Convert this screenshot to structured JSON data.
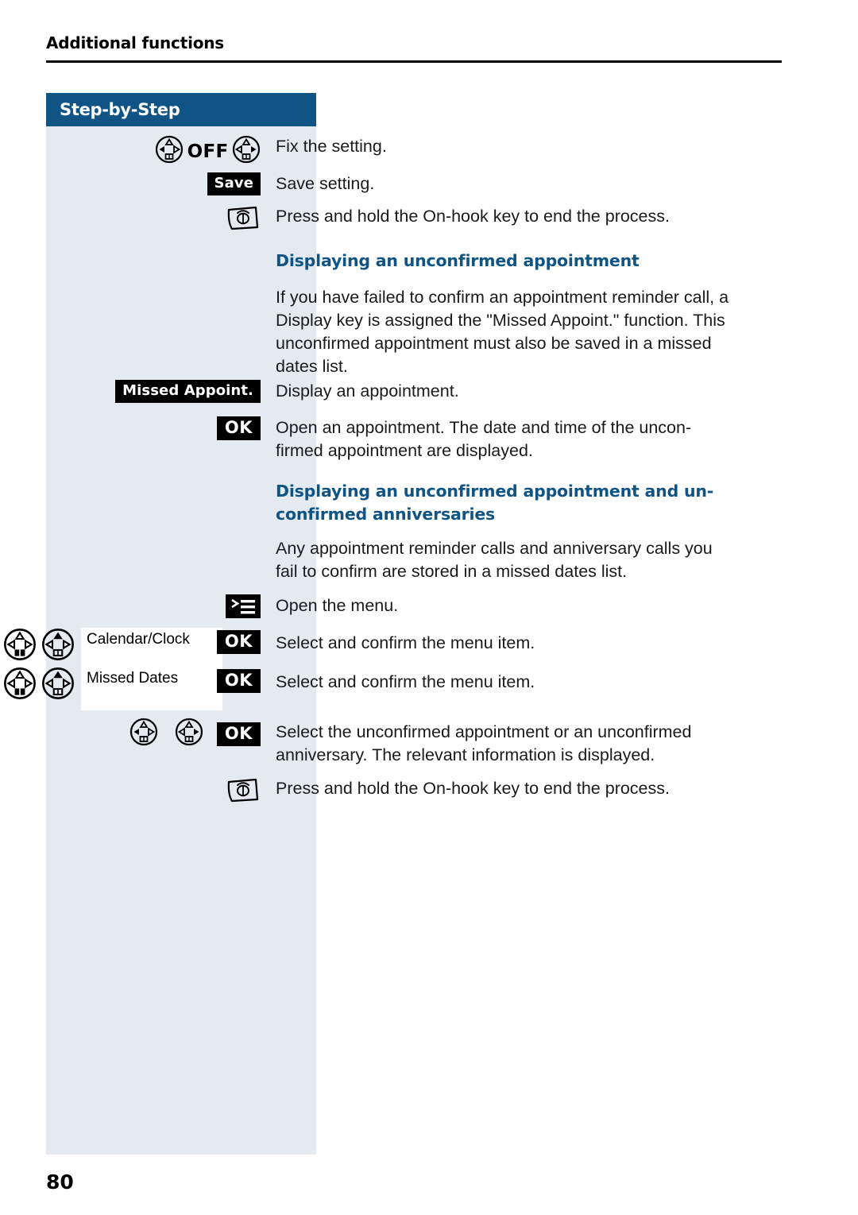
{
  "page": {
    "running_head": "Additional functions",
    "banner_title": "Step-by-Step",
    "page_number": "80",
    "colors": {
      "banner_blue": "#0f5485",
      "column_tint": "#e5eaf1",
      "heading_blue": "#0f5485",
      "keycap_black": "#000000"
    }
  },
  "rows": [
    {
      "id": "fix-setting",
      "gutter": {
        "type": "navkeys-with-label",
        "left_key": "nav-key-left-icon",
        "label": "OFF",
        "right_key": "nav-key-right-icon"
      },
      "text": "Fix the setting."
    },
    {
      "id": "save-setting",
      "gutter": {
        "type": "keycap",
        "label": "Save"
      },
      "text": "Save setting."
    },
    {
      "id": "on-hook-end-1",
      "gutter": {
        "type": "icon",
        "icon": "on-hook-key-icon"
      },
      "text": "Press and hold the On-hook key to end the process."
    },
    {
      "id": "heading-displaying-unconfirmed",
      "gutter": {
        "type": "none"
      },
      "heading": "Displaying an unconfirmed appointment"
    },
    {
      "id": "paragraph-missed-appoint",
      "gutter": {
        "type": "none"
      },
      "text": "If you have failed to confirm an appointment reminder call, a Display key is assigned the \"Missed Appoint.\" function. This unconfirmed appointment must also be saved in a missed dates list."
    },
    {
      "id": "display-appointment",
      "gutter": {
        "type": "keycap",
        "label": "Missed Appoint."
      },
      "text": "Display an appointment."
    },
    {
      "id": "open-appointment",
      "gutter": {
        "type": "keycap-ok",
        "label": "OK"
      },
      "text": "Open an appointment. The date and time of the uncon-firmed appointment are displayed."
    },
    {
      "id": "heading-displaying-unconfirmed-anniversaries",
      "gutter": {
        "type": "none"
      },
      "heading": "Displaying an unconfirmed appointment and un-confirmed anniversaries"
    },
    {
      "id": "paragraph-missed-dates-list",
      "gutter": {
        "type": "none"
      },
      "text": "Any appointment reminder calls and anniversary calls you fail to confirm are stored in a missed dates list."
    },
    {
      "id": "open-menu",
      "gutter": {
        "type": "icon",
        "icon": "menu-icon"
      },
      "text": "Open the menu."
    },
    {
      "id": "select-calendar-clock",
      "gutter": {
        "type": "navkeys-display-ok",
        "display_text": "Calendar/Clock",
        "ok_label": "OK"
      },
      "text": "Select and confirm the menu item."
    },
    {
      "id": "select-missed-dates",
      "gutter": {
        "type": "navkeys-display-ok",
        "display_text": "Missed Dates",
        "ok_label": "OK"
      },
      "text": "Select and confirm the menu item."
    },
    {
      "id": "select-unconfirmed",
      "gutter": {
        "type": "navkeys-ok",
        "ok_label": "OK"
      },
      "text": "Select the unconfirmed appointment or an unconfirmed anniversary. The relevant information is displayed."
    },
    {
      "id": "on-hook-end-2",
      "gutter": {
        "type": "icon",
        "icon": "on-hook-key-icon"
      },
      "text": "Press and hold the On-hook key to end the process."
    }
  ],
  "texts": {
    "fix_setting": "Fix the setting.",
    "save_setting": "Save setting.",
    "on_hook_1": "Press and hold the On-hook key to end the process.",
    "heading_1": "Displaying an unconfirmed appointment",
    "para_1": "If you have failed to confirm an appointment reminder call, a Display key is assigned the \"Missed Appoint.\" function. This unconfirmed appointment must also be saved in a missed dates list.",
    "display_appointment": "Display an appointment.",
    "open_appointment_line1": "Open an appointment. The date and time of the uncon-",
    "open_appointment_line2": "firmed appointment are displayed.",
    "heading_2_line1": "Displaying an unconfirmed appointment and un-",
    "heading_2_line2": "confirmed anniversaries",
    "para_2": "Any appointment reminder calls and anniversary calls you fail to confirm are stored in a missed dates list.",
    "open_menu": "Open the menu.",
    "select_confirm_1": "Select and confirm the menu item.",
    "select_confirm_2": "Select and confirm the menu item.",
    "select_unconfirmed": "Select the unconfirmed appointment or an unconfirmed anniversary. The relevant information is displayed.",
    "on_hook_2": "Press and hold the On-hook key to end the process."
  },
  "keys": {
    "off_label": "OFF",
    "save_label": "Save",
    "missed_appoint_label": "Missed Appoint.",
    "ok_label": "OK",
    "calendar_clock": "Calendar/Clock",
    "missed_dates": "Missed Dates"
  }
}
